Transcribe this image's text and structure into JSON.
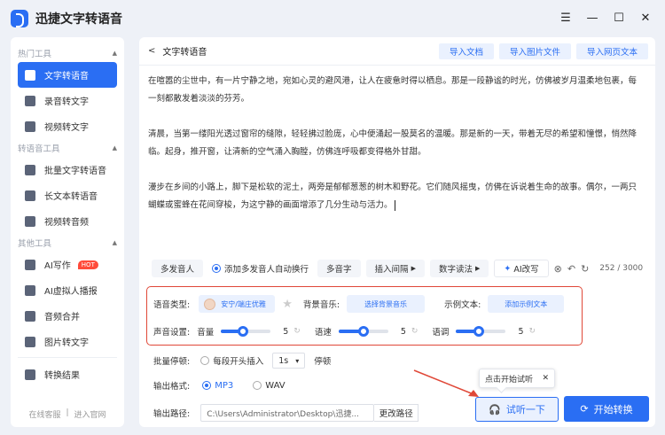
{
  "app": {
    "title": "迅捷文字转语音"
  },
  "sidebar": {
    "sections": [
      {
        "title": "热门工具",
        "items": [
          {
            "label": "文字转语音",
            "active": true
          },
          {
            "label": "录音转文字"
          },
          {
            "label": "视频转文字"
          }
        ]
      },
      {
        "title": "转语音工具",
        "items": [
          {
            "label": "批量文字转语音"
          },
          {
            "label": "长文本转语音"
          },
          {
            "label": "视频转音频"
          }
        ]
      },
      {
        "title": "其他工具",
        "items": [
          {
            "label": "AI写作",
            "badge": "HOT"
          },
          {
            "label": "AI虚拟人播报"
          },
          {
            "label": "音频合并"
          },
          {
            "label": "图片转文字"
          }
        ]
      }
    ],
    "results": "转换结果",
    "footer": {
      "service": "在线客服",
      "sep": "|",
      "website": "进入官网"
    }
  },
  "main": {
    "back": "<",
    "title": "文字转语音",
    "imports": [
      "导入文档",
      "导入图片文件",
      "导入网页文本"
    ],
    "paragraphs": [
      "在喧嚣的尘世中，有一片宁静之地，宛如心灵的避风港，让人在疲惫时得以栖息。那是一段静谧的时光，仿佛被岁月温柔地包裹，每一刻都散发着淡淡的芬芳。",
      "清晨，当第一缕阳光透过窗帘的缝隙，轻轻拂过脸庞，心中便涌起一股莫名的温暖。那是新的一天，带着无尽的希望和憧憬，悄然降临。起身，推开窗，让清新的空气涌入胸膛，仿佛连呼吸都变得格外甘甜。",
      "漫步在乡间的小路上，脚下是松软的泥土，两旁是郁郁葱葱的树木和野花。它们随风摇曳，仿佛在诉说着生命的故事。偶尔，一两只蝴蝶或蜜蜂在花间穿梭，为这宁静的画面增添了几分生动与活力。"
    ],
    "toolbar": {
      "multi_speaker": "多发音人",
      "auto_wrap": "添加多发音人自动换行",
      "polyphone": "多音字",
      "insert_pause": "插入间隔",
      "number_read": "数字读法",
      "ai_rewrite": "AI改写",
      "counter": "252 / 3000"
    },
    "settings": {
      "voice_type_label": "语音类型:",
      "voice_name": "安宁/端庄优雅",
      "bg_music_label": "背景音乐:",
      "bg_music_btn": "选择背景音乐",
      "example_label": "示例文本:",
      "example_btn": "添加示例文本",
      "sound_label": "声音设置:",
      "sliders": [
        {
          "label": "音量",
          "value": 5,
          "fraction": 0.45
        },
        {
          "label": "语速",
          "value": 5,
          "fraction": 0.5
        },
        {
          "label": "语调",
          "value": 5,
          "fraction": 0.45
        }
      ]
    },
    "batch": {
      "label": "批量停顿:",
      "option": "每段开头插入",
      "select_value": "1s",
      "after": "停顿"
    },
    "format": {
      "label": "输出格式:",
      "options": [
        "MP3",
        "WAV"
      ],
      "selected": "MP3"
    },
    "output": {
      "label": "输出路径:",
      "path": "C:\\Users\\Administrator\\Desktop\\迅捷...",
      "change": "更改路径"
    },
    "tooltip": "点击开始试听",
    "listen_btn": "试听一下",
    "start_btn": "开始转换"
  },
  "colors": {
    "accent": "#2a6ef3",
    "highlight_box": "#e04838"
  }
}
